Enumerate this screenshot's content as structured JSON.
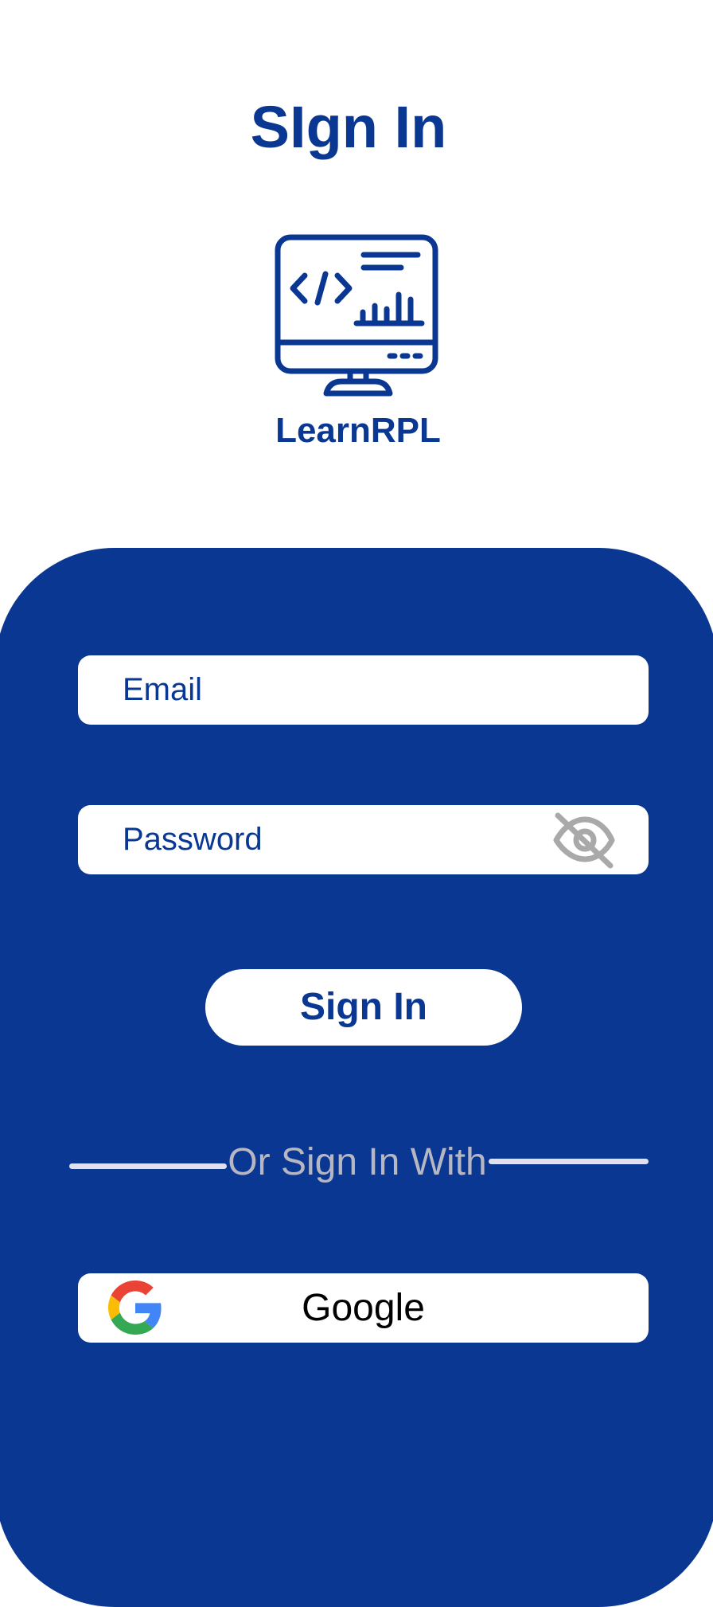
{
  "header": {
    "title": "SIgn In"
  },
  "brand": {
    "logo_icon": "computer-monitor-code-icon",
    "name": "LearnRPL"
  },
  "form": {
    "email_placeholder": "Email",
    "password_placeholder": "Password",
    "password_toggle_icon": "eye-off-icon",
    "submit_label": "Sign In"
  },
  "social": {
    "divider_text": "Or Sign In With",
    "google_label": "Google",
    "google_icon": "google-g-icon"
  },
  "colors": {
    "primary": "#0a3791",
    "background": "#ffffff",
    "divider": "#e3e0ee",
    "muted_text": "#b7b7c4"
  }
}
